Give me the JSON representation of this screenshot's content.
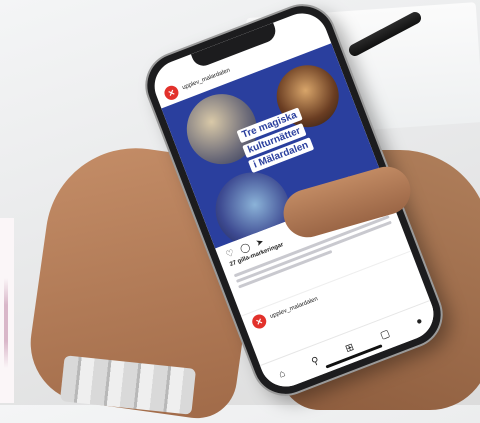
{
  "post": {
    "account": "upplev_malardalen",
    "headline_line1": "Tre magiska",
    "headline_line2": "kulturnätter",
    "headline_line3": "i Mälardalen",
    "likes": "27 gilla-markeringar",
    "next_account": "upplev_malardalen"
  },
  "colors": {
    "brand_red": "#e2312b",
    "post_blue": "#2a3f9e"
  },
  "icons": {
    "like": "heart-icon",
    "comment": "comment-icon",
    "share": "send-icon",
    "save": "bookmark-icon",
    "home": "home-icon",
    "search": "search-icon",
    "add": "plus-icon",
    "shop": "bag-icon",
    "profile": "profile-icon"
  }
}
